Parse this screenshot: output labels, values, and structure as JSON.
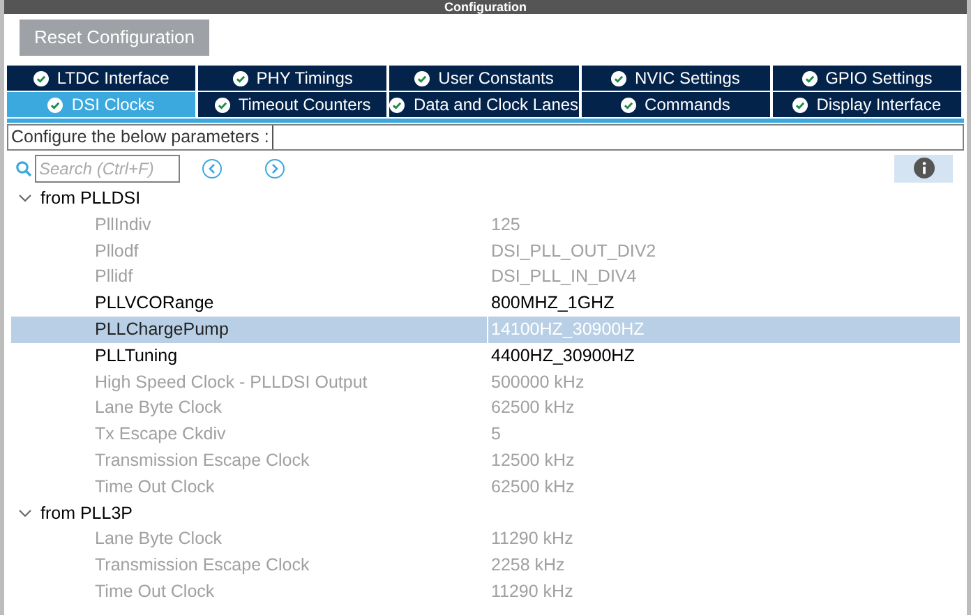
{
  "window": {
    "title": "Configuration"
  },
  "reset_button": "Reset Configuration",
  "tab_rows": [
    [
      {
        "label": "LTDC Interface",
        "selected": false
      },
      {
        "label": "PHY Timings",
        "selected": false
      },
      {
        "label": "User Constants",
        "selected": false
      },
      {
        "label": "NVIC Settings",
        "selected": false
      },
      {
        "label": "GPIO Settings",
        "selected": false
      }
    ],
    [
      {
        "label": "DSI Clocks",
        "selected": true
      },
      {
        "label": "Timeout Counters",
        "selected": false
      },
      {
        "label": "Data and Clock Lanes",
        "selected": false
      },
      {
        "label": "Commands",
        "selected": false
      },
      {
        "label": "Display Interface",
        "selected": false
      }
    ]
  ],
  "description": "Configure the below parameters :",
  "search": {
    "placeholder": "Search (Ctrl+F)"
  },
  "groups": [
    {
      "label": "from PLLDSI",
      "expanded": true,
      "children": [
        {
          "name": "PllIndiv",
          "value": "125",
          "disabled": true,
          "selected": false
        },
        {
          "name": "Pllodf",
          "value": "DSI_PLL_OUT_DIV2",
          "disabled": true,
          "selected": false
        },
        {
          "name": "Pllidf",
          "value": "DSI_PLL_IN_DIV4",
          "disabled": true,
          "selected": false
        },
        {
          "name": "PLLVCORange",
          "value": "800MHZ_1GHZ",
          "disabled": false,
          "selected": false
        },
        {
          "name": "PLLChargePump",
          "value": "14100HZ_30900HZ",
          "disabled": false,
          "selected": true
        },
        {
          "name": "PLLTuning",
          "value": "4400HZ_30900HZ",
          "disabled": false,
          "selected": false
        },
        {
          "name": "High Speed Clock - PLLDSI Output",
          "value": "500000 kHz",
          "disabled": true,
          "selected": false
        },
        {
          "name": "Lane Byte Clock",
          "value": "62500 kHz",
          "disabled": true,
          "selected": false
        },
        {
          "name": "Tx Escape Ckdiv",
          "value": "5",
          "disabled": true,
          "selected": false
        },
        {
          "name": "Transmission Escape Clock",
          "value": "12500 kHz",
          "disabled": true,
          "selected": false
        },
        {
          "name": "Time Out Clock",
          "value": "62500 kHz",
          "disabled": true,
          "selected": false
        }
      ]
    },
    {
      "label": "from PLL3P",
      "expanded": true,
      "children": [
        {
          "name": "Lane Byte Clock",
          "value": "11290 kHz",
          "disabled": true,
          "selected": false
        },
        {
          "name": "Transmission Escape Clock",
          "value": "2258 kHz",
          "disabled": true,
          "selected": false
        },
        {
          "name": "Time Out Clock",
          "value": "11290 kHz",
          "disabled": true,
          "selected": false
        }
      ]
    }
  ]
}
